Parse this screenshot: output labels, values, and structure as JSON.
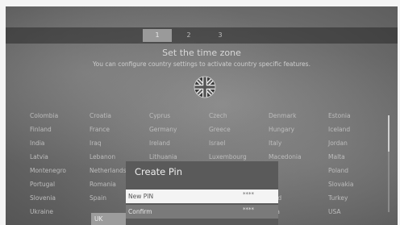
{
  "steps": [
    "1",
    "2",
    "3"
  ],
  "active_step": 1,
  "header": {
    "title": "Set the time zone",
    "subtitle": "You can configure country settings to activate country specific features."
  },
  "flag_icon": "uk-flag-icon",
  "countries": [
    [
      "Colombia",
      "Croatia",
      "Cyprus",
      "Czech",
      "Denmark",
      "Estonia"
    ],
    [
      "Finland",
      "France",
      "Germany",
      "Greece",
      "Hungary",
      "Iceland"
    ],
    [
      "India",
      "Iraq",
      "Ireland",
      "Israel",
      "Italy",
      "Jordan"
    ],
    [
      "Latvia",
      "Lebanon",
      "Lithuania",
      "Luxembourg",
      "Macedonia",
      "Malta"
    ],
    [
      "Montenegro",
      "Netherlands",
      "",
      "",
      "",
      "Poland"
    ],
    [
      "Portugal",
      "Romania",
      "",
      "",
      "ia",
      "Slovakia"
    ],
    [
      "Slovenia",
      "Spain",
      "",
      "",
      "land",
      "Turkey"
    ],
    [
      "Ukraine",
      "UK",
      "",
      "",
      "ada",
      "USA"
    ]
  ],
  "selected_country": "UK",
  "dialog": {
    "title": "Create Pin",
    "new_pin_label": "New PIN",
    "new_pin_value": "****",
    "confirm_label": "Confirm",
    "confirm_value": "****"
  },
  "colors": {
    "selected_bg": "#9c9c9c",
    "dialog_bg": "#5a5a5a",
    "focused_row": "#f4f4f4"
  }
}
